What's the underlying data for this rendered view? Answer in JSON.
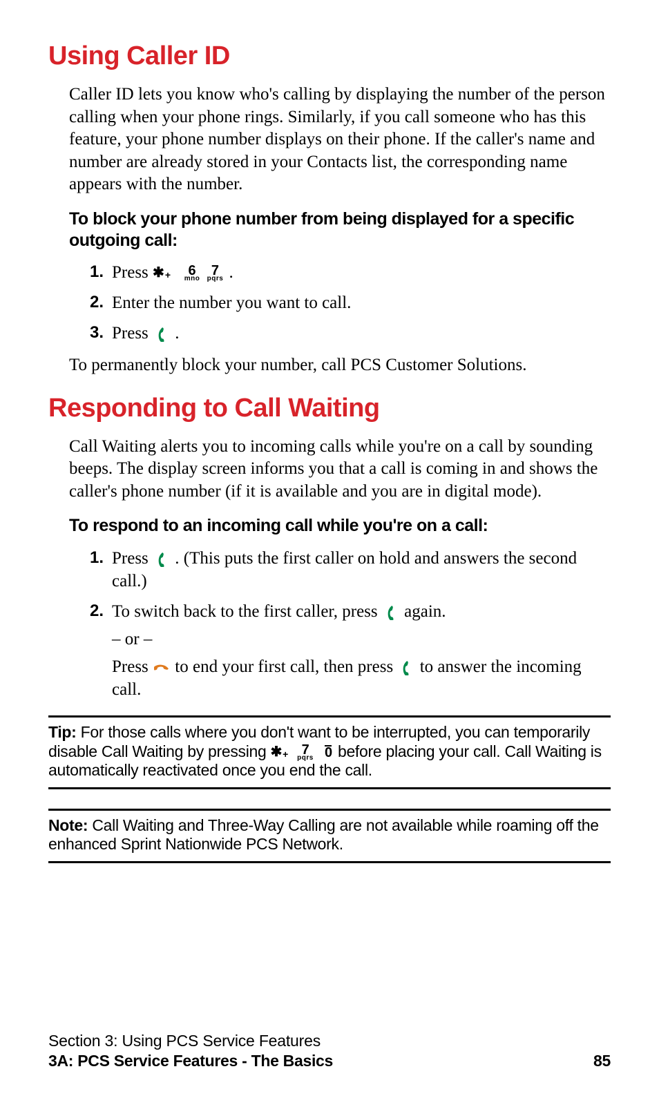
{
  "section1": {
    "heading": "Using Caller ID",
    "para": "Caller ID lets you know who's calling by displaying the number of the person calling when your phone rings. Similarly, if you call someone who has this feature, your phone number displays on their phone. If the caller's name and number are already stored in your Contacts list, the corresponding name appears with the number.",
    "subhead": "To block your phone number from being displayed for a specific outgoing call:",
    "steps": [
      {
        "num": "1.",
        "pre": "Press ",
        "post": " ."
      },
      {
        "num": "2.",
        "text": "Enter the number you want to call."
      },
      {
        "num": "3.",
        "pre": "Press ",
        "post": " ."
      }
    ],
    "follow": "To permanently block your number, call PCS Customer Solutions."
  },
  "section2": {
    "heading": "Responding to Call Waiting",
    "para": "Call Waiting alerts you to incoming calls while you're on a call by sounding beeps. The display screen informs you that a call is coming in and shows the caller's phone number (if it is available and you are in digital mode).",
    "subhead": "To respond to an incoming call while you're on a call:",
    "steps": [
      {
        "num": "1.",
        "pre": "Press ",
        "post": " . (This puts the first caller on hold and answers the second call.)"
      },
      {
        "num": "2.",
        "pre": "To switch back to the first caller, press ",
        "post": " again.",
        "or": "– or –",
        "line2_a": " Press ",
        "line2_b": " to end your first call, then press ",
        "line2_c": " to answer the incoming call."
      }
    ]
  },
  "tip": {
    "lead": "Tip:",
    "a": " For those calls where you don't want to be interrupted, you can temporarily disable Call Waiting by pressing ",
    "b": " before placing your call. Call Waiting is automatically reactivated once you end the call."
  },
  "note": {
    "lead": "Note:",
    "text": " Call Waiting and Three-Way Calling are not available while roaming off the enhanced Sprint Nationwide PCS Network."
  },
  "footer": {
    "line1": "Section 3: Using PCS Service Features",
    "line2": "3A: PCS Service Features - The Basics",
    "page": "85"
  },
  "keys": {
    "six": "6",
    "mno": "mno",
    "seven": "7",
    "pqrs": "pqrs",
    "zero": "0"
  }
}
